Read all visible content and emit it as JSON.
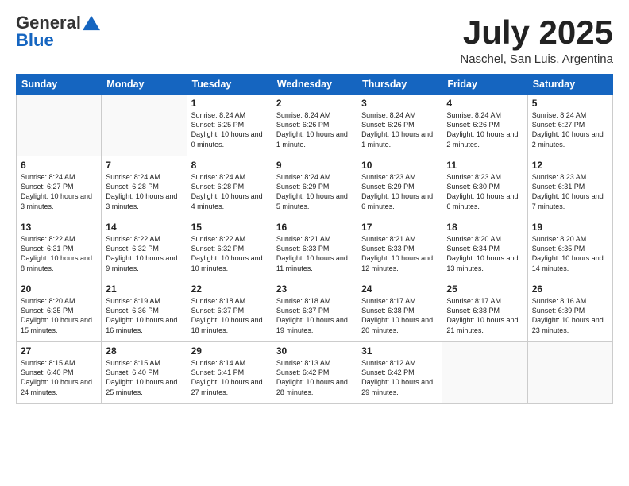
{
  "header": {
    "logo_general": "General",
    "logo_blue": "Blue",
    "month_title": "July 2025",
    "location": "Naschel, San Luis, Argentina"
  },
  "weekdays": [
    "Sunday",
    "Monday",
    "Tuesday",
    "Wednesday",
    "Thursday",
    "Friday",
    "Saturday"
  ],
  "weeks": [
    [
      {
        "day": "",
        "info": ""
      },
      {
        "day": "",
        "info": ""
      },
      {
        "day": "1",
        "info": "Sunrise: 8:24 AM\nSunset: 6:25 PM\nDaylight: 10 hours and 0 minutes."
      },
      {
        "day": "2",
        "info": "Sunrise: 8:24 AM\nSunset: 6:26 PM\nDaylight: 10 hours and 1 minute."
      },
      {
        "day": "3",
        "info": "Sunrise: 8:24 AM\nSunset: 6:26 PM\nDaylight: 10 hours and 1 minute."
      },
      {
        "day": "4",
        "info": "Sunrise: 8:24 AM\nSunset: 6:26 PM\nDaylight: 10 hours and 2 minutes."
      },
      {
        "day": "5",
        "info": "Sunrise: 8:24 AM\nSunset: 6:27 PM\nDaylight: 10 hours and 2 minutes."
      }
    ],
    [
      {
        "day": "6",
        "info": "Sunrise: 8:24 AM\nSunset: 6:27 PM\nDaylight: 10 hours and 3 minutes."
      },
      {
        "day": "7",
        "info": "Sunrise: 8:24 AM\nSunset: 6:28 PM\nDaylight: 10 hours and 3 minutes."
      },
      {
        "day": "8",
        "info": "Sunrise: 8:24 AM\nSunset: 6:28 PM\nDaylight: 10 hours and 4 minutes."
      },
      {
        "day": "9",
        "info": "Sunrise: 8:24 AM\nSunset: 6:29 PM\nDaylight: 10 hours and 5 minutes."
      },
      {
        "day": "10",
        "info": "Sunrise: 8:23 AM\nSunset: 6:29 PM\nDaylight: 10 hours and 6 minutes."
      },
      {
        "day": "11",
        "info": "Sunrise: 8:23 AM\nSunset: 6:30 PM\nDaylight: 10 hours and 6 minutes."
      },
      {
        "day": "12",
        "info": "Sunrise: 8:23 AM\nSunset: 6:31 PM\nDaylight: 10 hours and 7 minutes."
      }
    ],
    [
      {
        "day": "13",
        "info": "Sunrise: 8:22 AM\nSunset: 6:31 PM\nDaylight: 10 hours and 8 minutes."
      },
      {
        "day": "14",
        "info": "Sunrise: 8:22 AM\nSunset: 6:32 PM\nDaylight: 10 hours and 9 minutes."
      },
      {
        "day": "15",
        "info": "Sunrise: 8:22 AM\nSunset: 6:32 PM\nDaylight: 10 hours and 10 minutes."
      },
      {
        "day": "16",
        "info": "Sunrise: 8:21 AM\nSunset: 6:33 PM\nDaylight: 10 hours and 11 minutes."
      },
      {
        "day": "17",
        "info": "Sunrise: 8:21 AM\nSunset: 6:33 PM\nDaylight: 10 hours and 12 minutes."
      },
      {
        "day": "18",
        "info": "Sunrise: 8:20 AM\nSunset: 6:34 PM\nDaylight: 10 hours and 13 minutes."
      },
      {
        "day": "19",
        "info": "Sunrise: 8:20 AM\nSunset: 6:35 PM\nDaylight: 10 hours and 14 minutes."
      }
    ],
    [
      {
        "day": "20",
        "info": "Sunrise: 8:20 AM\nSunset: 6:35 PM\nDaylight: 10 hours and 15 minutes."
      },
      {
        "day": "21",
        "info": "Sunrise: 8:19 AM\nSunset: 6:36 PM\nDaylight: 10 hours and 16 minutes."
      },
      {
        "day": "22",
        "info": "Sunrise: 8:18 AM\nSunset: 6:37 PM\nDaylight: 10 hours and 18 minutes."
      },
      {
        "day": "23",
        "info": "Sunrise: 8:18 AM\nSunset: 6:37 PM\nDaylight: 10 hours and 19 minutes."
      },
      {
        "day": "24",
        "info": "Sunrise: 8:17 AM\nSunset: 6:38 PM\nDaylight: 10 hours and 20 minutes."
      },
      {
        "day": "25",
        "info": "Sunrise: 8:17 AM\nSunset: 6:38 PM\nDaylight: 10 hours and 21 minutes."
      },
      {
        "day": "26",
        "info": "Sunrise: 8:16 AM\nSunset: 6:39 PM\nDaylight: 10 hours and 23 minutes."
      }
    ],
    [
      {
        "day": "27",
        "info": "Sunrise: 8:15 AM\nSunset: 6:40 PM\nDaylight: 10 hours and 24 minutes."
      },
      {
        "day": "28",
        "info": "Sunrise: 8:15 AM\nSunset: 6:40 PM\nDaylight: 10 hours and 25 minutes."
      },
      {
        "day": "29",
        "info": "Sunrise: 8:14 AM\nSunset: 6:41 PM\nDaylight: 10 hours and 27 minutes."
      },
      {
        "day": "30",
        "info": "Sunrise: 8:13 AM\nSunset: 6:42 PM\nDaylight: 10 hours and 28 minutes."
      },
      {
        "day": "31",
        "info": "Sunrise: 8:12 AM\nSunset: 6:42 PM\nDaylight: 10 hours and 29 minutes."
      },
      {
        "day": "",
        "info": ""
      },
      {
        "day": "",
        "info": ""
      }
    ]
  ]
}
